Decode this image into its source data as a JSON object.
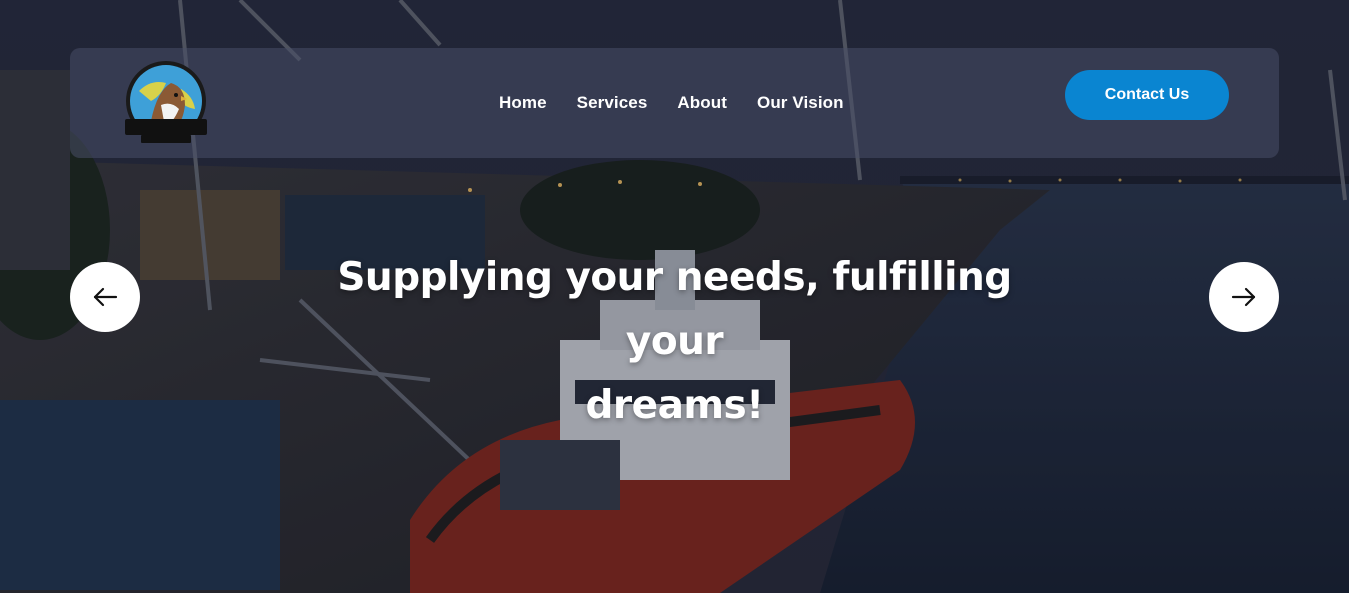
{
  "header": {
    "logo": {
      "icon": "hawk-globe-logo",
      "title": "HAWK EYES",
      "subtitle": "ENTERPRISES"
    },
    "nav_items": [
      {
        "label": "Home"
      },
      {
        "label": "Services"
      },
      {
        "label": "About"
      },
      {
        "label": "Our Vision"
      }
    ],
    "cta_label": "Contact Us"
  },
  "hero": {
    "headline_line1": "Supplying your needs, fulfilling your",
    "headline_line2": "dreams!",
    "background": "harbor-tugboat-night-photo",
    "prev_icon": "arrow-left-icon",
    "next_icon": "arrow-right-icon"
  },
  "colors": {
    "accent": "#0a85d1",
    "text": "#ffffff",
    "nav_bg": "#484e68"
  }
}
